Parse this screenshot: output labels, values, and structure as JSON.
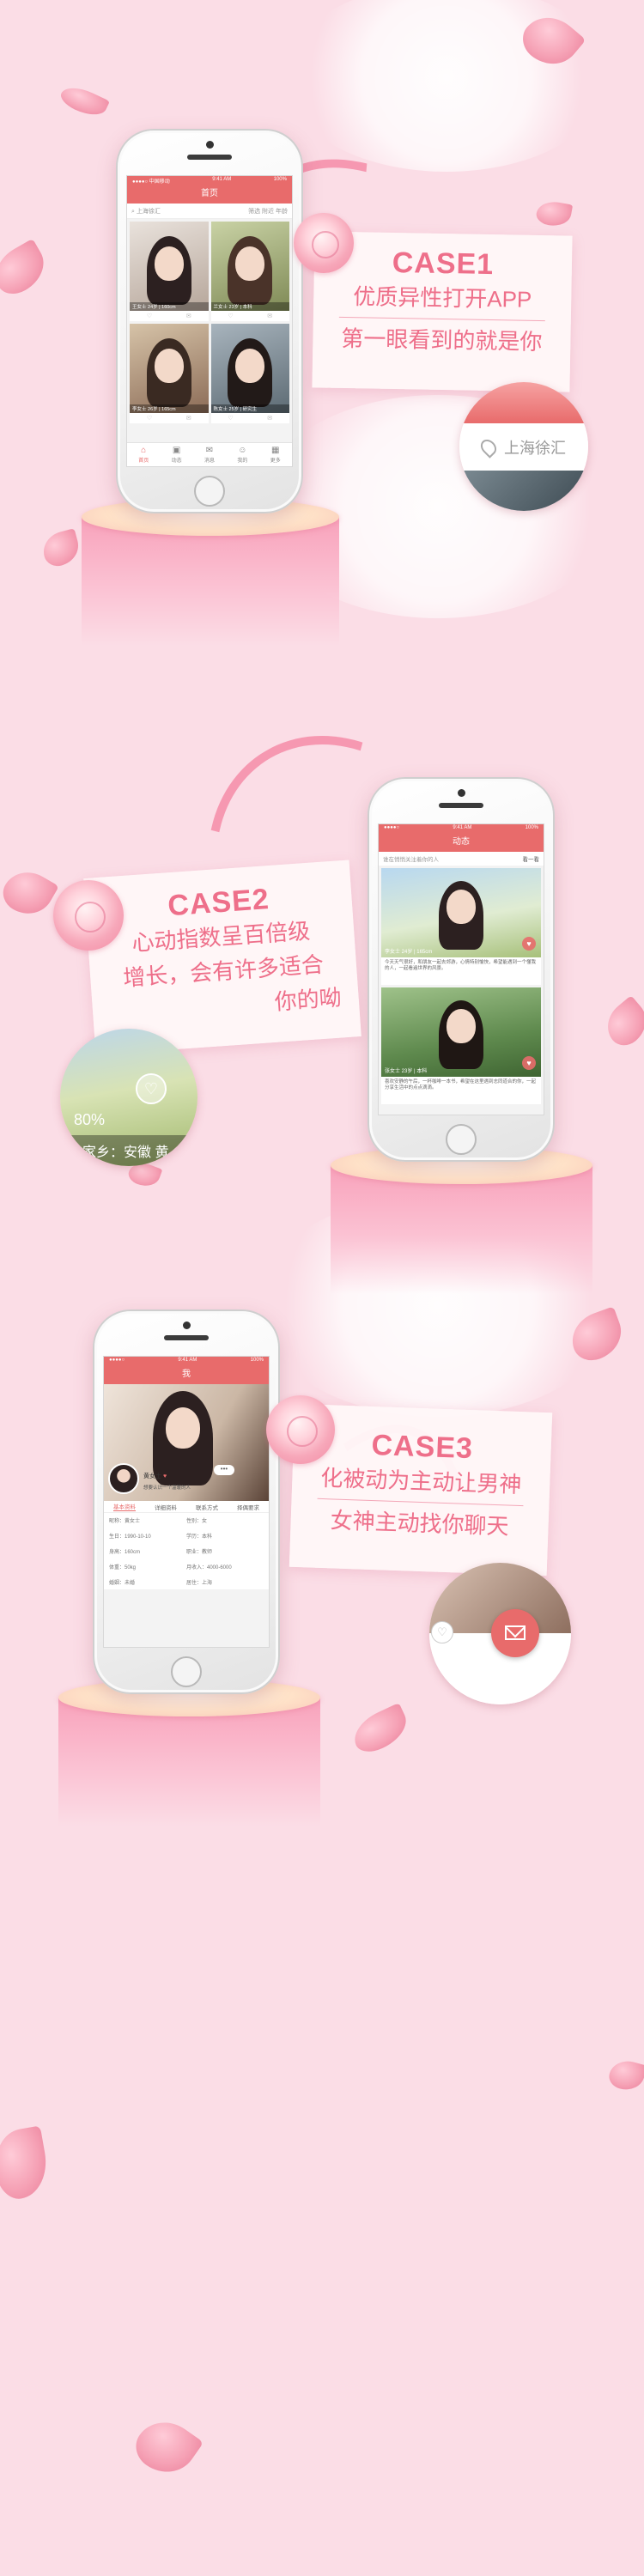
{
  "colors": {
    "background": "#fbdde6",
    "accent": "#ee6f8a",
    "app_red": "#e86b6b"
  },
  "case1": {
    "title": "CASE1",
    "line1": "优质异性打开APP",
    "line2": "第一眼看到的就是你",
    "location_label": "上海徐汇",
    "location_icon": "location-pin-icon"
  },
  "case2": {
    "title": "CASE2",
    "line1": "心动指数呈百倍级",
    "line2": "增长，会有许多适合",
    "line3": "你的呦",
    "bubble_percent": "80%",
    "bubble_home": "家乡：安徽 黄"
  },
  "case3": {
    "title": "CASE3",
    "line1": "化被动为主动让男神",
    "line2": "女神主动找你聊天",
    "mail_icon": "envelope-icon"
  },
  "phone1": {
    "status_left": "●●●●○ 中国移动",
    "status_time": "9:41 AM",
    "status_right": "100%",
    "nav_title": "首页",
    "search_placeholder": "上海徐汇",
    "filter_label": "筛选 附近 年龄",
    "cards": [
      {
        "caption": "王女士 24岁 | 160cm"
      },
      {
        "caption": "兰女士 23岁 | 本科"
      },
      {
        "caption": "李女士 26岁 | 165cm"
      },
      {
        "caption": "陈女士 25岁 | 研究生"
      }
    ],
    "tabs": [
      {
        "label": "首页",
        "icon": "home-icon"
      },
      {
        "label": "动态",
        "icon": "feed-icon"
      },
      {
        "label": "消息",
        "icon": "message-icon"
      },
      {
        "label": "我的",
        "icon": "user-icon"
      },
      {
        "label": "更多",
        "icon": "grid-icon"
      }
    ]
  },
  "phone2": {
    "status_time": "9:41 AM",
    "nav_title": "动态",
    "tip_text": "谁在悄悄关注着你的人",
    "tip_action": "看一看",
    "posts": [
      {
        "caption": "李女士 24岁 | 165cm",
        "text": "今天天气很好，和朋友一起去郊游，心情特别愉快，希望能遇到一个懂我的人，一起看遍世界的风景。"
      },
      {
        "caption": "张女士 23岁 | 本科",
        "text": "喜欢安静的午后，一杯咖啡一本书，希望在这里遇到志同道合的你，一起分享生活中的点点滴滴。"
      }
    ]
  },
  "phone3": {
    "status_time": "9:41 AM",
    "nav_title": "我",
    "name": "黄女士",
    "subtitle": "想要认识一个温暖的人",
    "tabs": [
      "基本资料",
      "详细资料",
      "联系方式",
      "择偶要求"
    ],
    "fields": [
      "昵称：黄女士",
      "性别：女",
      "生日：1990-10-10",
      "学历：本科",
      "身高：160cm",
      "职业：教师",
      "体重：50kg",
      "月收入：4000-6000",
      "婚姻：未婚",
      "居住：上海"
    ]
  }
}
